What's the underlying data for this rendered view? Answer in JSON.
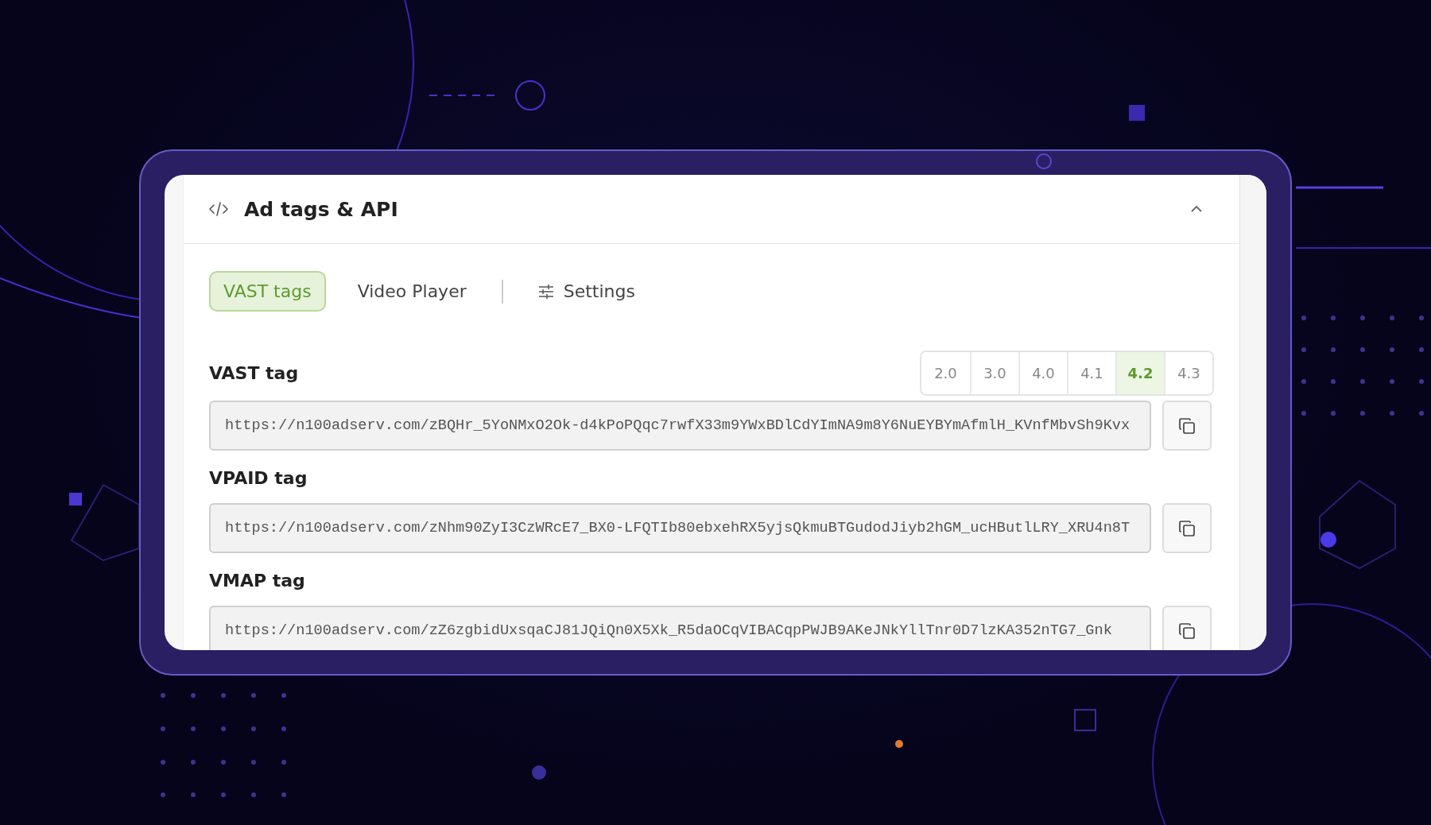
{
  "header": {
    "title": "Ad tags & API",
    "expanded": true
  },
  "tabs": [
    {
      "label": "VAST tags",
      "selected": true,
      "kind": "pill"
    },
    {
      "label": "Video Player",
      "selected": false,
      "kind": "pill"
    },
    {
      "label": "Settings",
      "selected": false,
      "kind": "settings"
    }
  ],
  "tags": [
    {
      "label": "VAST tag",
      "url": "https://n100adserv.com/zBQHr_5YoNMxO2Ok-d4kPoPQqc7rwfX33m9YWxBDlCdYImNA9m8Y6NuEYBYmAfmlH_KVnfMbvSh9Kvx",
      "versions": [
        {
          "label": "2.0",
          "selected": false
        },
        {
          "label": "3.0",
          "selected": false
        },
        {
          "label": "4.0",
          "selected": false
        },
        {
          "label": "4.1",
          "selected": false
        },
        {
          "label": "4.2",
          "selected": true
        },
        {
          "label": "4.3",
          "selected": false
        }
      ]
    },
    {
      "label": "VPAID tag",
      "url": "https://n100adserv.com/zNhm90ZyI3CzWRcE7_BX0-LFQTIb80ebxehRX5yjsQkmuBTGudodJiyb2hGM_ucHButlLRY_XRU4n8T"
    },
    {
      "label": "VMAP tag",
      "url": "https://n100adserv.com/zZ6zgbidUxsqaCJ81JQiQn0X5Xk_R5daOCqVIBACqpPWJB9AKeJNkYllTnr0D7lzKA352nTG7_Gnk"
    }
  ]
}
